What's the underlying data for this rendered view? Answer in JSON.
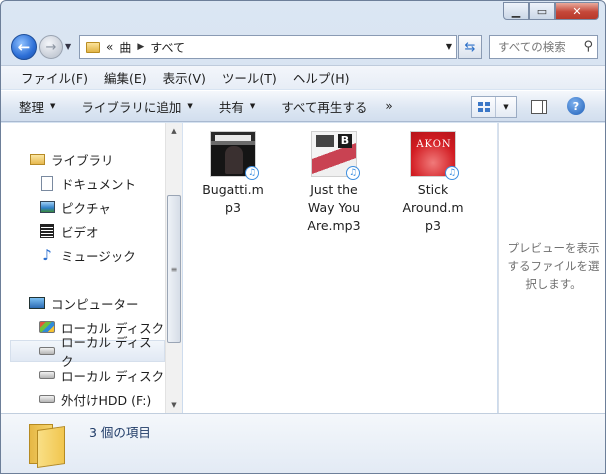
{
  "window": {
    "caption": {
      "minimize_icon": "minimize-icon",
      "maximize_icon": "maximize-icon",
      "close_icon": "close-icon"
    }
  },
  "address_bar": {
    "overflow": "«",
    "segments": [
      "曲",
      "すべて"
    ]
  },
  "search": {
    "placeholder": "すべての検索"
  },
  "menu": [
    "ファイル(F)",
    "編集(E)",
    "表示(V)",
    "ツール(T)",
    "ヘルプ(H)"
  ],
  "commands": {
    "organize": "整理",
    "add_to_library": "ライブラリに追加",
    "share": "共有",
    "play_all": "すべて再生する",
    "more": "»"
  },
  "nav_pane": {
    "libraries": {
      "label": "ライブラリ",
      "items": [
        {
          "label": "ドキュメント",
          "icon": "document-icon"
        },
        {
          "label": "ピクチャ",
          "icon": "picture-icon"
        },
        {
          "label": "ビデオ",
          "icon": "video-icon"
        },
        {
          "label": "ミュージック",
          "icon": "music-icon"
        }
      ]
    },
    "computer": {
      "label": "コンピューター",
      "items": [
        {
          "label": "ローカル ディスク",
          "icon": "windows-drive-icon",
          "selected": false
        },
        {
          "label": "ローカル ディスク",
          "icon": "drive-icon",
          "selected": true
        },
        {
          "label": "ローカル ディスク",
          "icon": "drive-icon",
          "selected": false
        },
        {
          "label": "外付けHDD (F:)",
          "icon": "drive-icon",
          "selected": false
        }
      ]
    }
  },
  "files": [
    {
      "name_line1": "Bugatti.m",
      "name_line2": "p3",
      "name_line3": ""
    },
    {
      "name_line1": "Just the",
      "name_line2": "Way You",
      "name_line3": "Are.mp3"
    },
    {
      "name_line1": "Stick",
      "name_line2": "Around.m",
      "name_line3": "p3"
    }
  ],
  "thumbnails": {
    "t2_letter": "B",
    "t3_text": "AKON"
  },
  "preview": {
    "line1": "プレビューを表示",
    "line2": "するファイルを選",
    "line3": "択します。"
  },
  "details": {
    "count": "3 個の項目"
  }
}
